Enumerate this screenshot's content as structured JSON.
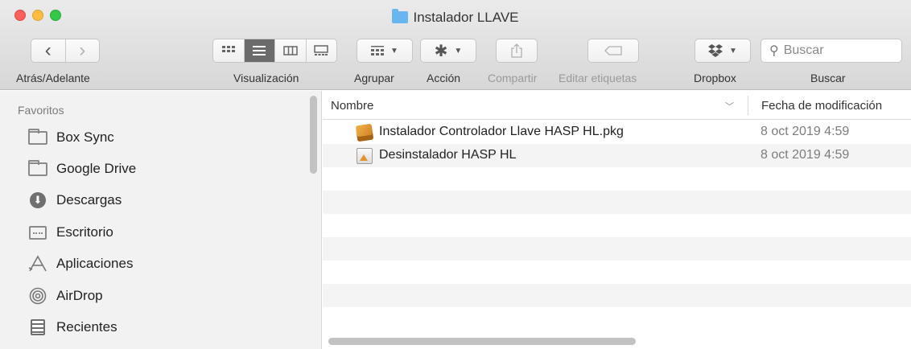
{
  "window": {
    "title": "Instalador LLAVE"
  },
  "toolbar": {
    "back_glyph": "‹",
    "forward_glyph": "›",
    "back_forward_label": "Atrás/Adelante",
    "view_label": "Visualización",
    "group_label": "Agrupar",
    "action_label": "Acción",
    "share_label": "Compartir",
    "tags_label": "Editar etiquetas",
    "dropbox_label": "Dropbox",
    "search_label": "Buscar",
    "search_placeholder": "Buscar",
    "view_modes": [
      "icon-view",
      "list-view",
      "column-view",
      "gallery-view"
    ],
    "active_view": "list-view"
  },
  "sidebar": {
    "section": "Favoritos",
    "items": [
      {
        "label": "Box Sync",
        "icon": "folder-icon"
      },
      {
        "label": "Google Drive",
        "icon": "folder-icon"
      },
      {
        "label": "Descargas",
        "icon": "download-icon"
      },
      {
        "label": "Escritorio",
        "icon": "desktop-icon"
      },
      {
        "label": "Aplicaciones",
        "icon": "applications-icon"
      },
      {
        "label": "AirDrop",
        "icon": "airdrop-icon"
      },
      {
        "label": "Recientes",
        "icon": "recents-icon"
      }
    ]
  },
  "file_list": {
    "columns": {
      "name": "Nombre",
      "date": "Fecha de modificación"
    },
    "rows": [
      {
        "name": "Instalador Controlador Llave HASP HL.pkg",
        "date": "8 oct 2019 4:59",
        "icon": "package-icon"
      },
      {
        "name": "Desinstalador HASP HL",
        "date": "8 oct 2019 4:59",
        "icon": "script-app-icon"
      }
    ]
  },
  "colors": {
    "close": "#fc605c",
    "minimize": "#fdbc40",
    "zoom": "#34c84a",
    "folder_accent": "#68b6ef"
  }
}
